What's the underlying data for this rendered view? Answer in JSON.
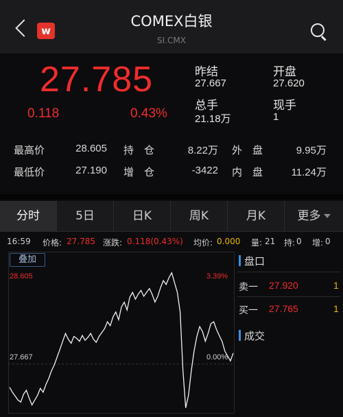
{
  "header": {
    "title": "COMEX白银",
    "subtitle": "SI.CMX",
    "logo_letter": "w"
  },
  "quote": {
    "price": "27.785",
    "change": "0.118",
    "change_pct": "0.43%",
    "prev_close_label": "昨结",
    "prev_close": "27.667",
    "open_label": "开盘",
    "open": "27.620",
    "volume_label": "总手",
    "volume": "21.18万",
    "current_hand_label": "现手",
    "current_hand": "1"
  },
  "stats": {
    "high_label": "最高价",
    "high": "28.605",
    "position_label": "持　仓",
    "position": "8.22万",
    "outer_label": "外　盘",
    "outer": "9.95万",
    "low_label": "最低价",
    "low": "27.190",
    "increase_label": "增　仓",
    "increase": "-3422",
    "inner_label": "内　盘",
    "inner": "11.24万"
  },
  "tabs": [
    "分时",
    "5日",
    "日K",
    "周K",
    "月K",
    "更多"
  ],
  "infoline": {
    "time": "16:59",
    "price_label": "价格:",
    "price": "27.785",
    "change_label": "涨跌:",
    "change": "0.118(0.43%)",
    "avg_label": "均价:",
    "avg": "0.000",
    "vol_label": "量:",
    "vol": "21",
    "hold_label": "持:",
    "hold": "0",
    "inc_label": "增:",
    "inc": "0"
  },
  "chart_data": {
    "type": "line",
    "overlay_label": "叠加",
    "y_top_label": "28.605",
    "y_mid_label": "27.667",
    "pct_top_label": "3.39%",
    "pct_mid_label": "0.00%",
    "ylim": [
      27.19,
      28.605
    ],
    "series": [
      {
        "values": [
          27.43,
          27.38,
          27.34,
          27.3,
          27.28,
          27.36,
          27.4,
          27.32,
          27.25,
          27.3,
          27.35,
          27.42,
          27.38,
          27.46,
          27.52,
          27.6,
          27.66,
          27.74,
          27.82,
          27.9,
          27.98,
          27.92,
          27.88,
          27.95,
          27.93,
          27.9,
          27.96,
          27.91,
          27.94,
          27.98,
          27.92,
          27.89,
          27.95,
          27.99,
          28.03,
          28.1,
          28.06,
          28.15,
          28.2,
          28.12,
          28.25,
          28.3,
          28.22,
          28.35,
          28.4,
          28.33,
          28.38,
          28.42,
          28.36,
          28.4,
          28.44,
          28.38,
          28.3,
          28.36,
          28.45,
          28.52,
          28.48,
          28.55,
          28.6,
          28.5,
          28.4,
          28.2,
          27.6,
          27.22,
          27.35,
          27.6,
          27.8,
          27.95,
          28.05,
          28.0,
          27.9,
          27.98,
          28.08,
          28.1,
          28.02,
          27.96,
          27.9,
          27.8,
          27.75,
          27.7,
          27.78
        ]
      }
    ]
  },
  "orderbook": {
    "title": "盘口",
    "sell_label": "卖一",
    "sell_price": "27.920",
    "sell_qty": "1",
    "buy_label": "买一",
    "buy_price": "27.765",
    "buy_qty": "1",
    "trades_title": "成交"
  },
  "colors": {
    "up": "#f02c2c",
    "accent": "#3a8ee6",
    "qty": "#e6b800"
  }
}
